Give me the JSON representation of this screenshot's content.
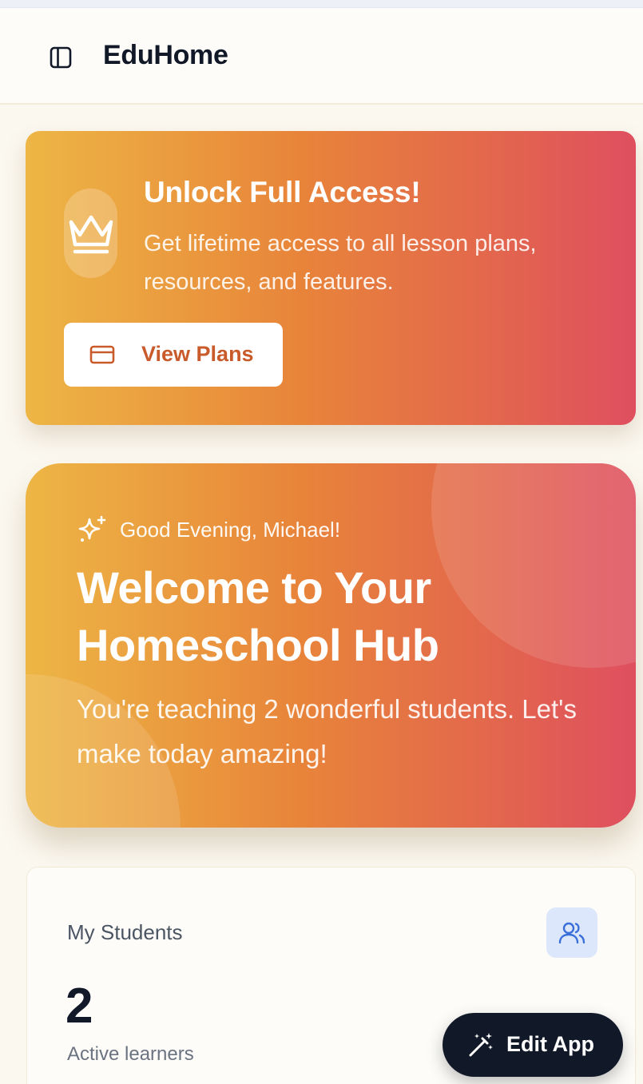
{
  "header": {
    "app_title": "EduHome"
  },
  "promo": {
    "title": "Unlock Full Access!",
    "text": "Get lifetime access to all lesson plans, resources, and features.",
    "button_label": "View Plans",
    "icon": "crown-icon"
  },
  "welcome": {
    "greeting": "Good Evening, Michael!",
    "title": "Welcome to Your Homeschool Hub",
    "subtitle": "You're teaching 2 wonderful students. Let's make today amazing!",
    "icon": "sparkles-icon"
  },
  "stats": {
    "students": {
      "label": "My Students",
      "value": "2",
      "sub": "Active learners",
      "icon": "users-icon"
    }
  },
  "floating": {
    "edit_label": "Edit App",
    "icon": "magic-wand-icon"
  },
  "colors": {
    "gradient_start": "#edb645",
    "gradient_mid": "#e8843a",
    "gradient_end": "#df4f5f",
    "dark": "#111827",
    "accent_button_text": "#c95a2a",
    "stat_icon_bg": "#dde7fb",
    "stat_icon_stroke": "#3b6fd8"
  }
}
